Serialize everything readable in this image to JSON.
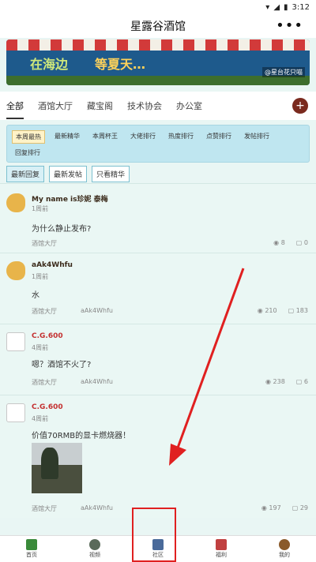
{
  "statusbar": {
    "time": "3:12",
    "wifi_icon": "wifi-icon",
    "signal_icon": "signal-icon",
    "battery_icon": "battery-icon"
  },
  "header": {
    "title": "星露谷酒馆",
    "more_label": "•••"
  },
  "banner": {
    "text_a": "在海边",
    "text_b": "等夏天…",
    "credit": "@星台花只喵"
  },
  "tabs": [
    {
      "label": "全部"
    },
    {
      "label": "酒馆大厅"
    },
    {
      "label": "藏宝阁"
    },
    {
      "label": "技术协会"
    },
    {
      "label": "办公室"
    }
  ],
  "tabs_plus": "+",
  "ranking": [
    {
      "label": "本周最热"
    },
    {
      "label": "最新精华"
    },
    {
      "label": "本周杯王"
    },
    {
      "label": "大佬排行"
    },
    {
      "label": "热度排行"
    },
    {
      "label": "点赞排行"
    },
    {
      "label": "发帖排行"
    },
    {
      "label": "回复排行"
    }
  ],
  "sort": [
    {
      "label": "最新回复"
    },
    {
      "label": "最新发帖"
    },
    {
      "label": "只看精华"
    }
  ],
  "posts": [
    {
      "author": "My name is珍妮 泰梅",
      "time": "1周前",
      "content": "为什么静止发布?",
      "category": "酒馆大厅",
      "last_reply": "",
      "views": "8",
      "comments": "0"
    },
    {
      "author": "aAk4Whfu",
      "time": "1周前",
      "content": "水",
      "category": "酒馆大厅",
      "last_reply": "aAk4Whfu",
      "views": "210",
      "comments": "183"
    },
    {
      "author": "C.G.600",
      "time": "4周前",
      "content": "嗯？酒馆不火了?",
      "category": "酒馆大厅",
      "last_reply": "aAk4Whfu",
      "views": "238",
      "comments": "6"
    },
    {
      "author": "C.G.600",
      "time": "4周前",
      "content": "价值70RMB的显卡燃烧器！",
      "category": "酒馆大厅",
      "last_reply": "aAk4Whfu",
      "views": "197",
      "comments": "29"
    }
  ],
  "bottomnav": [
    {
      "label": "首页",
      "icon": "home-icon"
    },
    {
      "label": "视频",
      "icon": "video-icon"
    },
    {
      "label": "社区",
      "icon": "community-icon"
    },
    {
      "label": "福利",
      "icon": "gift-icon"
    },
    {
      "label": "我的",
      "icon": "profile-icon"
    }
  ],
  "colors": {
    "accent": "#7a2a1e",
    "highlight": "#e02020",
    "background": "#e9f6f4"
  }
}
